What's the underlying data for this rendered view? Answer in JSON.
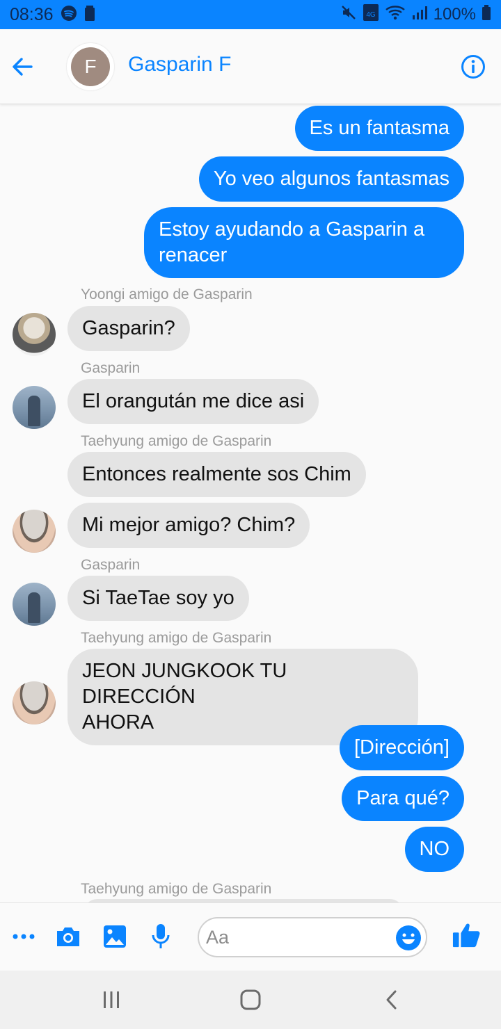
{
  "status_bar": {
    "time": "08:36",
    "battery": "100%",
    "network": "4G"
  },
  "header": {
    "avatar_initial": "F",
    "contact_name": "Gasparin F"
  },
  "messages": [
    {
      "type": "out",
      "text": "Es un fantasma"
    },
    {
      "type": "out",
      "text": "Yo veo algunos fantasmas"
    },
    {
      "type": "out",
      "text_lines": [
        "Estoy ayudando a Gasparin a",
        "renacer"
      ]
    },
    {
      "type": "sender",
      "text": "Yoongi amigo de Gasparin"
    },
    {
      "type": "in",
      "text": "Gasparin?"
    },
    {
      "type": "sender",
      "text": "Gasparin"
    },
    {
      "type": "in",
      "text": "El orangután me dice asi"
    },
    {
      "type": "sender",
      "text": "Taehyung amigo de Gasparin"
    },
    {
      "type": "in",
      "text": "Entonces realmente sos Chim"
    },
    {
      "type": "in",
      "text": "Mi mejor amigo? Chim?"
    },
    {
      "type": "sender",
      "text": "Gasparin"
    },
    {
      "type": "in",
      "text": "Si TaeTae soy yo"
    },
    {
      "type": "sender",
      "text": "Taehyung amigo de Gasparin"
    },
    {
      "type": "in",
      "text_lines": [
        "JEON JUNGKOOK TU DIRECCIÓN",
        "AHORA"
      ]
    },
    {
      "type": "out",
      "text": "[Dirección]"
    },
    {
      "type": "out",
      "text": "Para qué?"
    },
    {
      "type": "out",
      "text": "NO"
    },
    {
      "type": "sender",
      "text": "Taehyung amigo de Gasparin"
    }
  ],
  "composer": {
    "placeholder": "Aa"
  },
  "colors": {
    "accent": "#0a84ff",
    "incoming_bubble": "#e4e4e4",
    "sender_label": "#9a9a9a"
  }
}
